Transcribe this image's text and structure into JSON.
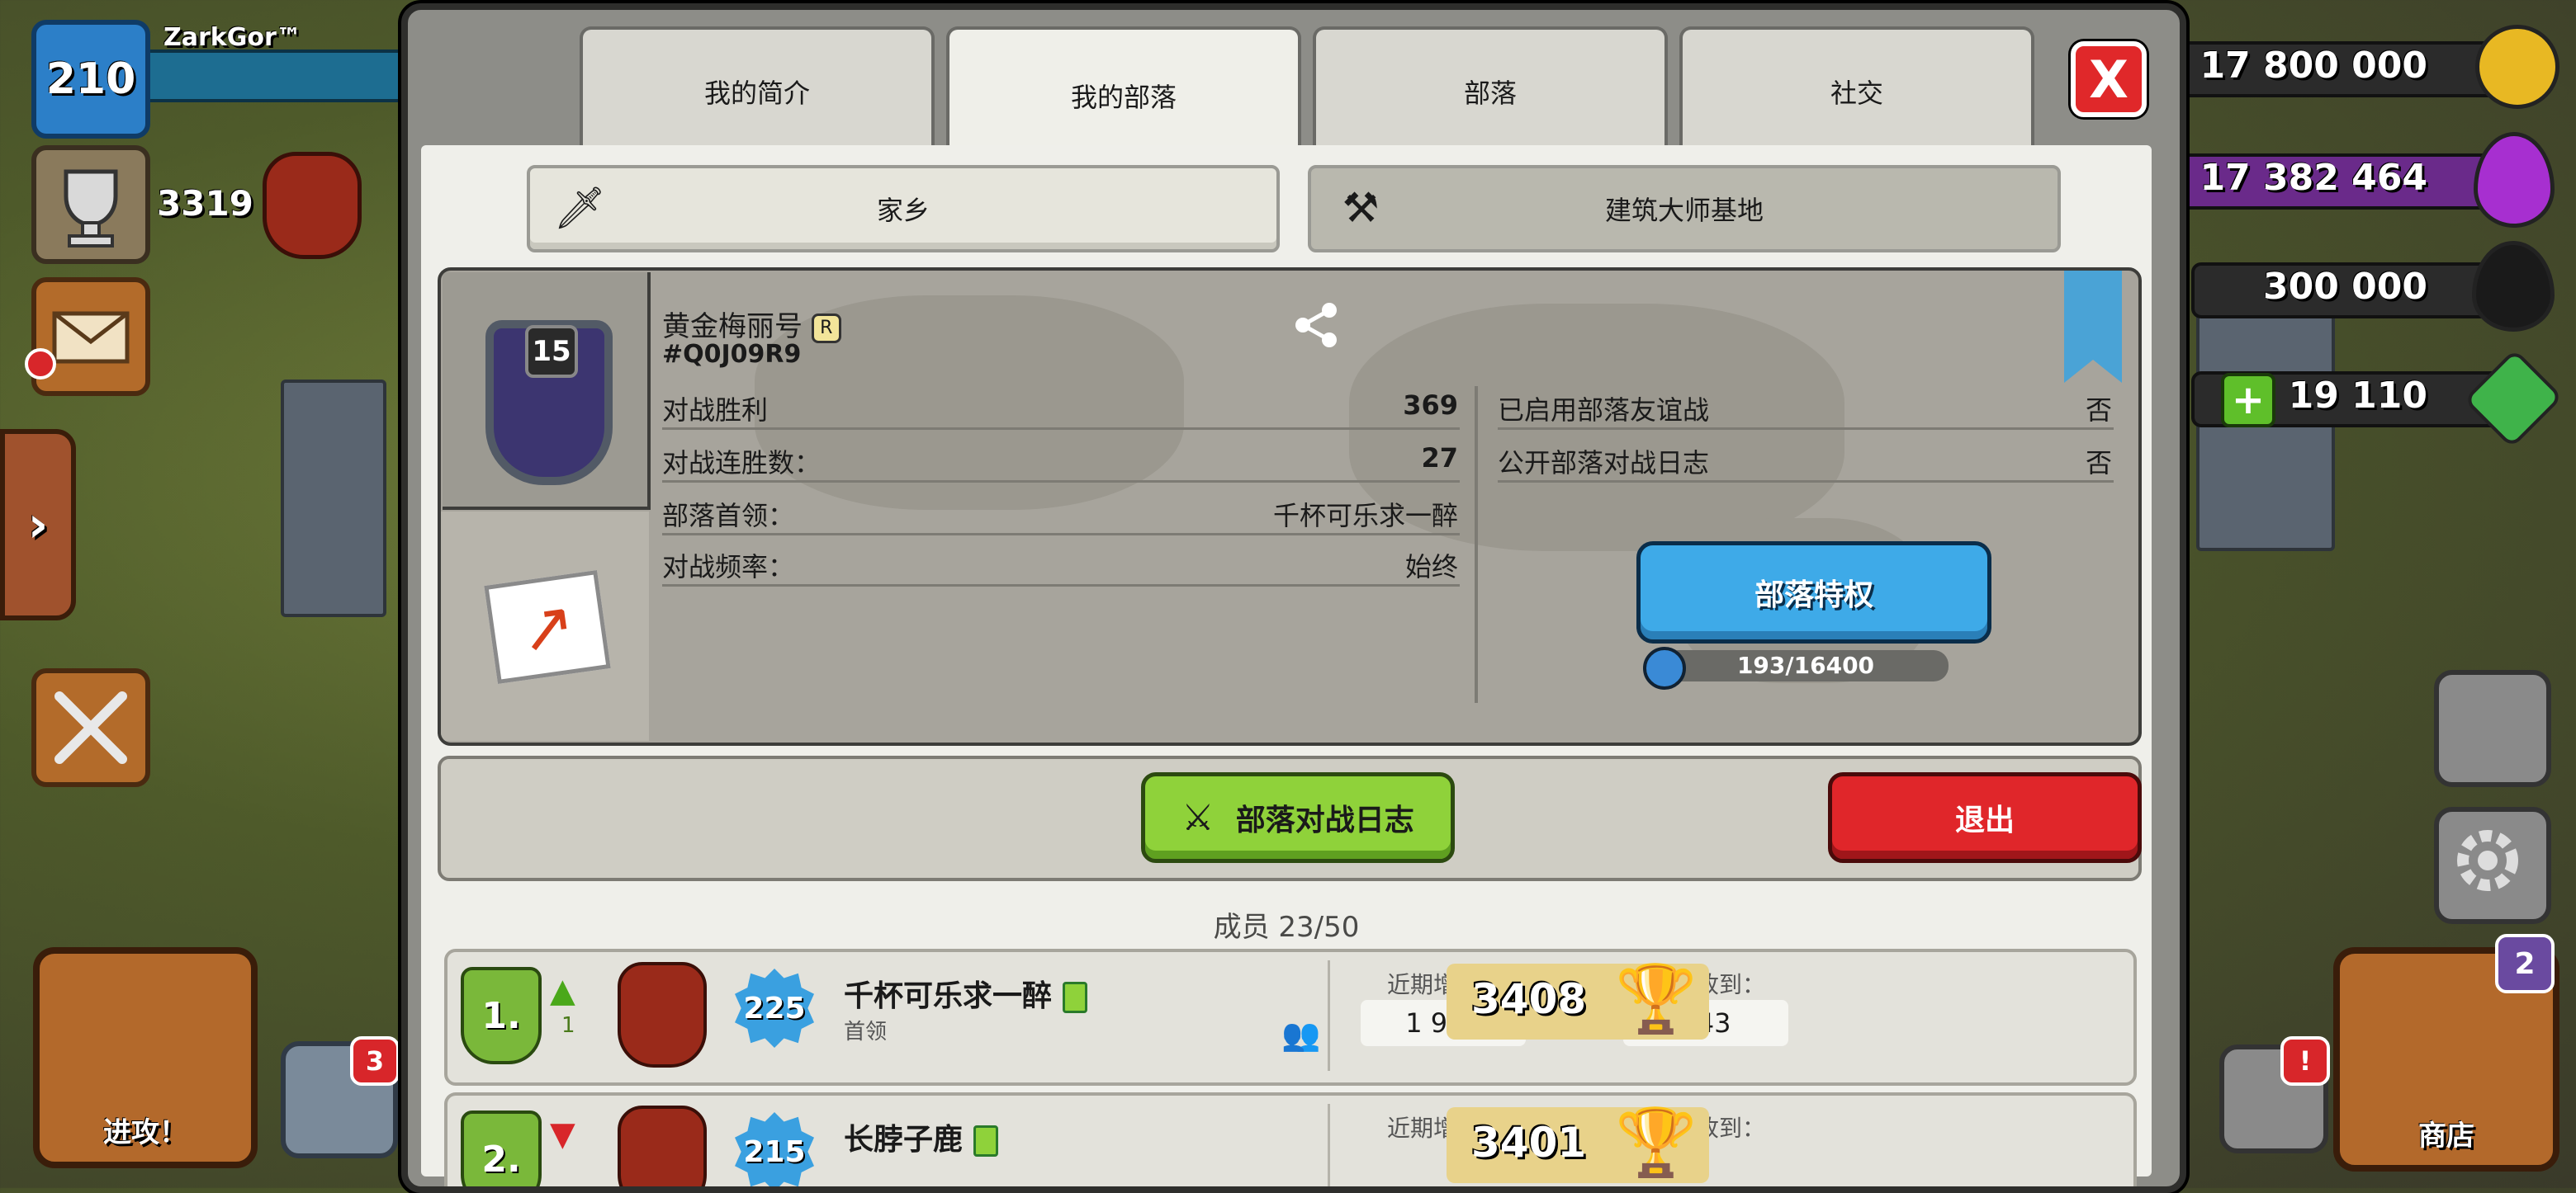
{
  "hud": {
    "player_level": "210",
    "player_name": "ZarkGor™",
    "trophies": "3319",
    "attack_label": "进攻！",
    "heal_badge": "3",
    "shop_label": "商店",
    "shop_badge": "2",
    "gold": "17 800 000",
    "elixir": "17 382 464",
    "dark_elixir": "300 000",
    "gems": "19 110",
    "side_arrow": "›"
  },
  "modal": {
    "tabs": [
      {
        "label": "我的简介"
      },
      {
        "label": "我的部落"
      },
      {
        "label": "部落"
      },
      {
        "label": "社交"
      }
    ],
    "close_label": "X",
    "subtabs": [
      {
        "label": "家乡"
      },
      {
        "label": "建筑大师基地"
      }
    ]
  },
  "clan": {
    "level": "15",
    "name": "黄金梅丽号",
    "tag": "#Q0J09R9",
    "left_stats": [
      {
        "label": "对战胜利",
        "value": "369"
      },
      {
        "label": "对战连胜数：",
        "value": "27"
      },
      {
        "label": "部落首领：",
        "value": "千杯可乐求一醉"
      },
      {
        "label": "对战频率：",
        "value": "始终"
      }
    ],
    "right_stats": [
      {
        "label": "已启用部落友谊战",
        "value": "否"
      },
      {
        "label": "公开部落对战日志",
        "value": "否"
      }
    ],
    "perks_button": "部落特权",
    "xp_progress": "193/16400",
    "xp_fraction": 0.0118
  },
  "actions": {
    "war_log_button": "部落对战日志",
    "leave_button": "退出"
  },
  "members": {
    "header": "成员 23/50",
    "donated_label": "近期增援：",
    "received_label": "近期收到：",
    "rows": [
      {
        "rank": "1.",
        "prev_rank": "1",
        "trend": "▲",
        "exp_level": "225",
        "name": "千杯可乐求一醉",
        "role": "首领",
        "donated": "1 911",
        "received": "743",
        "trophies": "3408"
      },
      {
        "rank": "2.",
        "prev_rank": "",
        "trend": "▼",
        "exp_level": "215",
        "name": "长脖子鹿",
        "role": "",
        "donated": "",
        "received": "",
        "trophies": "3401"
      }
    ]
  },
  "colors": {
    "accent_blue": "#3eaae8",
    "accent_green": "#8fd23a",
    "accent_red": "#e0262a",
    "panel": "#efefea"
  },
  "icons": [
    "trophy-icon",
    "mail-icon",
    "crossed-swords-icon",
    "share-icon",
    "sword-icon",
    "axes-icon",
    "friends-icon",
    "close-icon"
  ]
}
